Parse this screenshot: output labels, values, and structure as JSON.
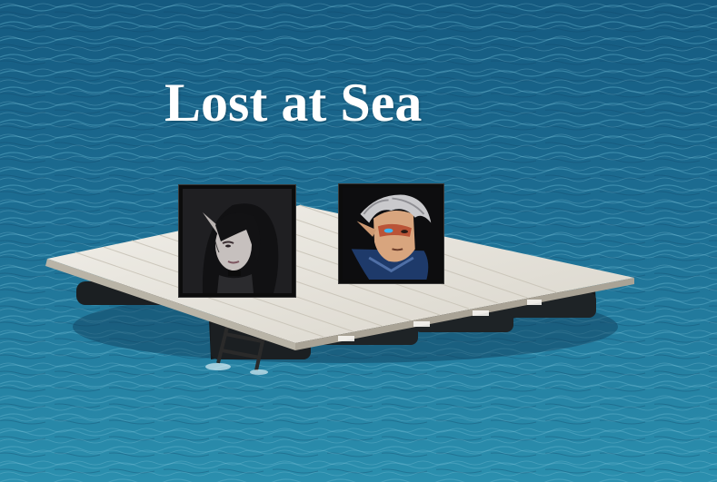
{
  "title": "Lost at Sea",
  "colors": {
    "sea_light": "#3f95b2",
    "sea_mid": "#1f6f93",
    "sea_deep": "#134f72",
    "raft_deck": "#e9e6df",
    "raft_plank_line": "#c9c4b8",
    "raft_pontoon": "#1b1f22",
    "title_text": "#ffffff",
    "portrait_frame": "#0c0c0c"
  },
  "portraits": [
    {
      "icon": "dark-haired-elf-woman-portrait-icon"
    },
    {
      "icon": "white-haired-elf-warrior-portrait-icon"
    }
  ]
}
